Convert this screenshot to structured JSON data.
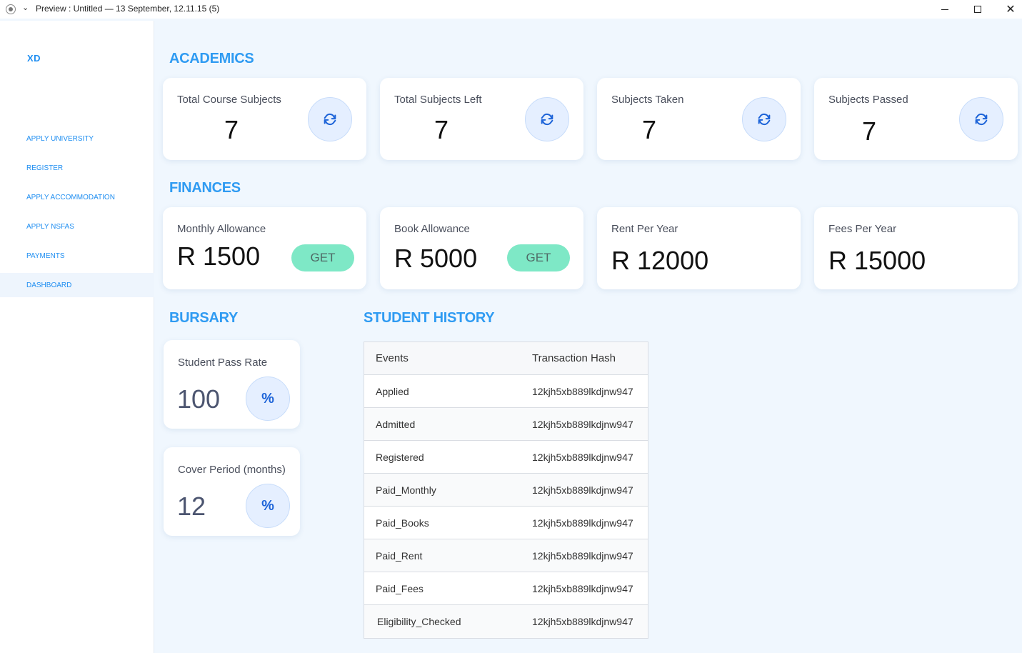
{
  "window": {
    "title": "Preview : Untitled — 13 September, 12.11.15 (5)"
  },
  "sidebar": {
    "logo": "XD",
    "items": [
      {
        "label": "APPLY UNIVERSITY",
        "active": false
      },
      {
        "label": "REGISTER",
        "active": false
      },
      {
        "label": "APPLY ACCOMMODATION",
        "active": false
      },
      {
        "label": "APPLY NSFAS",
        "active": false
      },
      {
        "label": "PAYMENTS",
        "active": false
      },
      {
        "label": "DASHBOARD",
        "active": true
      }
    ]
  },
  "academics": {
    "title": "ACADEMICS",
    "cards": [
      {
        "label": "Total Course Subjects",
        "value": "7"
      },
      {
        "label": "Total Subjects Left",
        "value": "7"
      },
      {
        "label": "Subjects Taken",
        "value": "7"
      },
      {
        "label": "Subjects Passed",
        "value": "7"
      }
    ]
  },
  "finances": {
    "title": "FINANCES",
    "cards": [
      {
        "label": "Monthly Allowance",
        "value": "R 1500",
        "button": "GET"
      },
      {
        "label": "Book Allowance",
        "value": "R 5000",
        "button": "GET"
      },
      {
        "label": "Rent Per Year",
        "value": "R 12000"
      },
      {
        "label": "Fees Per Year",
        "value": "R 15000"
      }
    ]
  },
  "bursary": {
    "title": "BURSARY",
    "cards": [
      {
        "label": "Student Pass Rate",
        "value": "100",
        "icon": "%"
      },
      {
        "label": "Cover Period (months)",
        "value": "12",
        "icon": "%"
      }
    ]
  },
  "history": {
    "title": "STUDENT HISTORY",
    "columns": [
      "Events",
      "Transaction Hash"
    ],
    "rows": [
      {
        "event": "Applied",
        "hash": "12kjh5xb889lkdjnw947"
      },
      {
        "event": "Admitted",
        "hash": "12kjh5xb889lkdjnw947"
      },
      {
        "event": "Registered",
        "hash": "12kjh5xb889lkdjnw947"
      },
      {
        "event": "Paid_Monthly",
        "hash": "12kjh5xb889lkdjnw947"
      },
      {
        "event": "Paid_Books",
        "hash": "12kjh5xb889lkdjnw947"
      },
      {
        "event": "Paid_Rent",
        "hash": "12kjh5xb889lkdjnw947"
      },
      {
        "event": "Paid_Fees",
        "hash": "12kjh5xb889lkdjnw947"
      },
      {
        "event": "Eligibility_Checked",
        "hash": "12kjh5xb889lkdjnw947"
      }
    ]
  },
  "colors": {
    "accent": "#2f9bf2",
    "get_button": "#7ee8c6",
    "icon_bg": "#e5efff"
  }
}
